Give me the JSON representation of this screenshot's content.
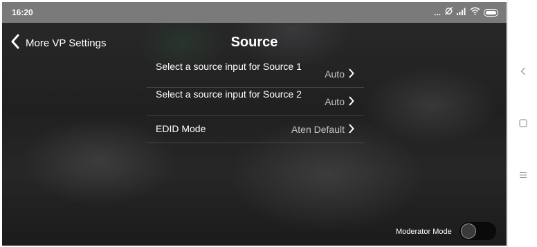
{
  "status_bar": {
    "time": "16:20",
    "dots": "...",
    "icons": [
      "alarm-off-icon",
      "signal-icon",
      "wifi-icon",
      "battery-icon"
    ]
  },
  "header": {
    "back_label": "More VP Settings",
    "title": "Source"
  },
  "settings": [
    {
      "label": "Select a source input for Source 1",
      "value": "Auto"
    },
    {
      "label": "Select a source input for Source 2",
      "value": "Auto"
    },
    {
      "label": "EDID Mode",
      "value": "Aten Default"
    }
  ],
  "footer": {
    "moderator_label": "Moderator Mode",
    "moderator_on": false
  },
  "nav": [
    "back-icon",
    "home-icon",
    "menu-icon"
  ],
  "colors": {
    "status_bar": "#7a7a7a",
    "value_text": "#c4c4c4",
    "toggle_track": "#0a0a0a"
  }
}
